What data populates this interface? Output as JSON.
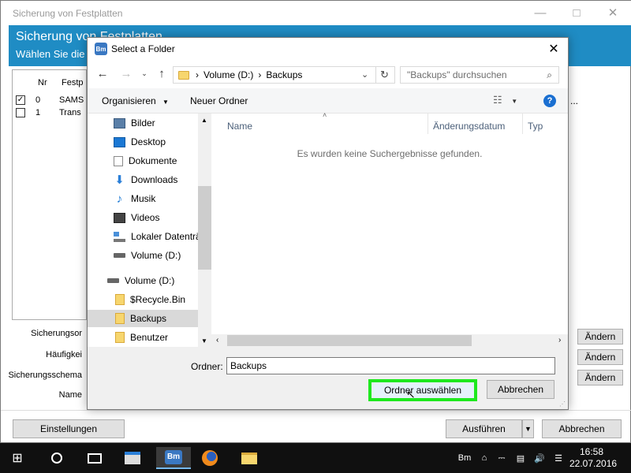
{
  "bg_app": {
    "title": "Sicherung von Festplatten",
    "header_title": "Sicherung von Festplatten",
    "header_sub": "Wählen Sie die",
    "list": {
      "col_nr": "Nr",
      "col_disk": "Festp",
      "rows": [
        {
          "checked": true,
          "nr": "0",
          "name": "SAMS"
        },
        {
          "checked": false,
          "nr": "1",
          "name": "Trans"
        }
      ]
    },
    "labels": {
      "location": "Sicherungsor",
      "frequency": "Häufigkei",
      "scheme": "Sicherungsschema",
      "name": "Name"
    },
    "change_label": "Ändern",
    "settings_button": "Einstellungen",
    "run_button": "Ausführen",
    "cancel_button": "Abbrechen",
    "more": "..."
  },
  "dialog": {
    "title": "Select a Folder",
    "app_icon_text": "Bm",
    "address": {
      "segments": [
        "Volume (D:)",
        "Backups"
      ]
    },
    "search_placeholder": "\"Backups\" durchsuchen",
    "toolbar": {
      "organize": "Organisieren",
      "new_folder": "Neuer Ordner"
    },
    "nav_items": [
      {
        "label": "Bilder",
        "icon": "pictures-icon",
        "color": "#5a7fa8"
      },
      {
        "label": "Desktop",
        "icon": "desktop-icon",
        "color": "#1a78d4"
      },
      {
        "label": "Dokumente",
        "icon": "documents-icon",
        "color": "#8a8a8a"
      },
      {
        "label": "Downloads",
        "icon": "downloads-icon",
        "color": "#2a7fd8"
      },
      {
        "label": "Musik",
        "icon": "music-icon",
        "color": "#1a78d4"
      },
      {
        "label": "Videos",
        "icon": "videos-icon",
        "color": "#444444"
      },
      {
        "label": "Lokaler Datenträ",
        "icon": "local-disk-icon",
        "color": "#4a90d9"
      },
      {
        "label": "Volume (D:)",
        "icon": "drive-icon",
        "color": "#666666"
      },
      {
        "label": "Volume (D:)",
        "icon": "drive-icon",
        "color": "#666666"
      },
      {
        "label": "$Recycle.Bin",
        "icon": "folder-icon",
        "color": "#f7d66e"
      },
      {
        "label": "Backups",
        "icon": "folder-icon",
        "color": "#f7d66e",
        "selected": true
      },
      {
        "label": "Benutzer",
        "icon": "folder-icon",
        "color": "#f7d66e"
      }
    ],
    "columns": {
      "name": "Name",
      "date": "Änderungsdatum",
      "type": "Typ"
    },
    "empty_message": "Es wurden keine Suchergebnisse gefunden.",
    "folder_label": "Ordner:",
    "folder_value": "Backups",
    "select_button": "Ordner auswählen",
    "cancel_button": "Abbrechen",
    "highlight_color": "#1ee81e"
  },
  "taskbar": {
    "app_icon_text": "Bm",
    "tray_icon_text": "Bm",
    "time": "16:58",
    "date": "22.07.2016"
  }
}
